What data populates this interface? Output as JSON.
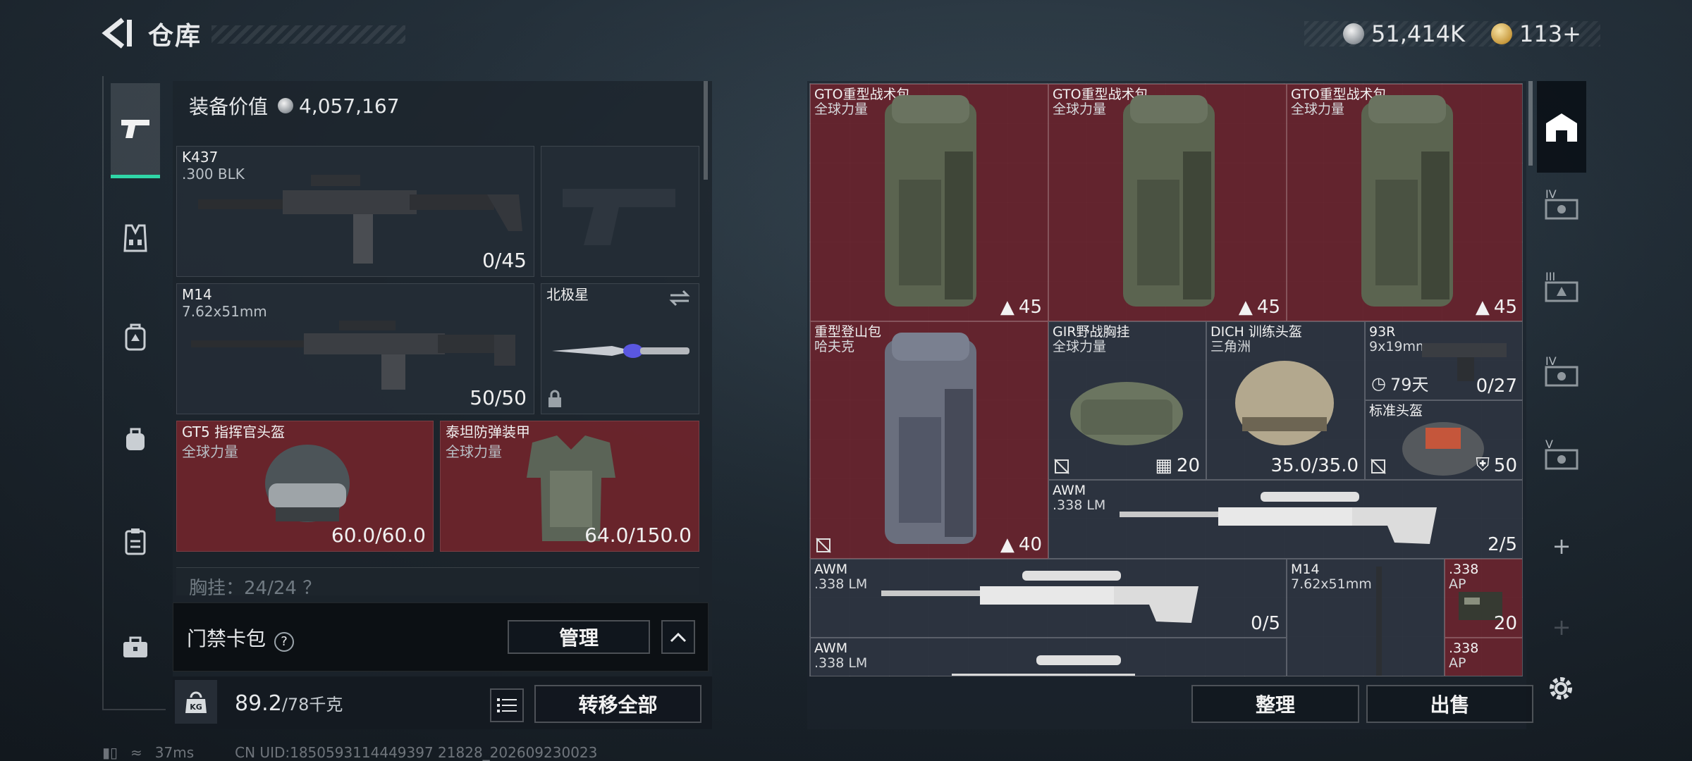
{
  "header": {
    "title": "仓库",
    "currency_silver": "51,414K",
    "currency_gold": "113+",
    "gold_plus_label": "+"
  },
  "left": {
    "equip_value_label": "装备价值",
    "equip_value": "4,057,167",
    "slots": [
      {
        "name": "K437",
        "sub": ".300 BLK",
        "qty": "0/45"
      },
      {
        "name": "M14",
        "sub": "7.62x51mm",
        "qty": "50/50"
      },
      {
        "name": "北极星"
      },
      {
        "name": "GT5 指挥官头盔",
        "sub": "全球力量",
        "qty": "60.0/60.0"
      },
      {
        "name": "泰坦防弹装甲",
        "sub": "全球力量",
        "qty": "64.0/150.0"
      }
    ],
    "chest_row": "胸挂：24/24 ？",
    "keycard_label": "门禁卡包",
    "manage_label": "管理",
    "weight_value": "89.2",
    "weight_capacity": "/78千克",
    "weight_unit_icon": "KG",
    "transfer_all_label": "转移全部"
  },
  "grid": {
    "items": [
      {
        "name": "GTO重型战术包",
        "sub": "全球力量",
        "qty": "45"
      },
      {
        "name": "GTO重型战术包",
        "sub": "全球力量",
        "qty": "45"
      },
      {
        "name": "GTO重型战术包",
        "sub": "全球力量",
        "qty": "45"
      },
      {
        "name": "重型登山包",
        "sub": "哈夫克",
        "qty": "40"
      },
      {
        "name": "GIR野战胸挂",
        "sub": "全球力量",
        "qty": "20"
      },
      {
        "name": "DICH 训练头盔",
        "sub": "三角洲",
        "qty": "35.0/35.0"
      },
      {
        "name": "93R",
        "sub": "9x19mm",
        "qty": "0/27",
        "timer": "79天"
      },
      {
        "name": "标准头盔",
        "qty": "50"
      },
      {
        "name": "AWM",
        "sub": ".338 LM",
        "qty": "2/5"
      },
      {
        "name": "AWM",
        "sub": ".338 LM",
        "qty": "0/5"
      },
      {
        "name": "M14",
        "sub": "7.62x51mm"
      },
      {
        "name": ".338",
        "sub": "AP",
        "qty": "20"
      },
      {
        "name": "AWM",
        "sub": ".338 LM"
      },
      {
        "name": ".338",
        "sub": "AP"
      }
    ],
    "sort_label": "整理",
    "sell_label": "出售"
  },
  "right_rail": [
    "IV",
    "III",
    "IV",
    "V"
  ],
  "status": {
    "ping": "37ms",
    "uid": "CN UID:1850593114449397 21828_202609230023"
  },
  "colors": {
    "accent": "#2fd6a7",
    "item_red": "#70222c",
    "panel": "#1c242c"
  }
}
